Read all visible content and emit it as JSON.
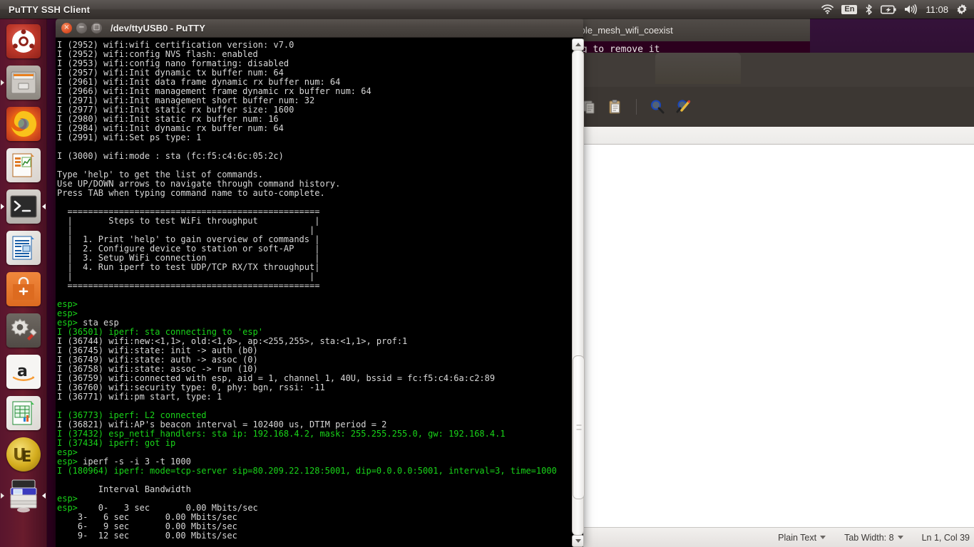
{
  "top_panel": {
    "app_title": "PuTTY SSH Client",
    "tray": {
      "wifi_icon": "wifi-icon",
      "keyboard_indicator": "En",
      "bluetooth_icon": "bluetooth-icon",
      "battery_icon": "battery-charging-icon",
      "volume_icon": "volume-icon",
      "clock": "11:08",
      "system_menu_icon": "gear-icon"
    }
  },
  "launcher": {
    "items": [
      {
        "name": "ubuntu-dash",
        "label": "Ubuntu Dash",
        "icon": "ubuntu-logo-icon"
      },
      {
        "name": "files",
        "label": "Files",
        "icon": "file-cabinet-icon"
      },
      {
        "name": "firefox",
        "label": "Firefox Web Browser",
        "icon": "firefox-icon"
      },
      {
        "name": "libreoffice-impress",
        "label": "LibreOffice Impress",
        "icon": "presentation-icon"
      },
      {
        "name": "terminal",
        "label": "Terminal",
        "icon": "terminal-icon"
      },
      {
        "name": "libreoffice-writer",
        "label": "LibreOffice Writer",
        "icon": "document-icon"
      },
      {
        "name": "ubuntu-software",
        "label": "Ubuntu Software",
        "icon": "software-bag-icon"
      },
      {
        "name": "system-settings",
        "label": "System Settings",
        "icon": "gear-wrench-icon"
      },
      {
        "name": "amazon",
        "label": "Amazon",
        "icon": "amazon-icon"
      },
      {
        "name": "libreoffice-calc",
        "label": "LibreOffice Calc",
        "icon": "spreadsheet-icon"
      },
      {
        "name": "ultraedit",
        "label": "UltraEdit",
        "icon": "ue-icon"
      },
      {
        "name": "workspace-switcher",
        "label": "Workspace Switcher",
        "icon": "window-stack-icon"
      }
    ]
  },
  "putty_window": {
    "title": "/dev/ttyUSB0 - PuTTY",
    "close_label": "×",
    "minimize_label": "−",
    "maximize_label": "□",
    "terminal_lines": [
      {
        "t": "I (2952) wifi:wifi certification version: v7.0",
        "c": "white"
      },
      {
        "t": "I (2952) wifi:config NVS flash: enabled",
        "c": "white"
      },
      {
        "t": "I (2953) wifi:config nano formating: disabled",
        "c": "white"
      },
      {
        "t": "I (2957) wifi:Init dynamic tx buffer num: 64",
        "c": "white"
      },
      {
        "t": "I (2961) wifi:Init data frame dynamic rx buffer num: 64",
        "c": "white"
      },
      {
        "t": "I (2966) wifi:Init management frame dynamic rx buffer num: 64",
        "c": "white"
      },
      {
        "t": "I (2971) wifi:Init management short buffer num: 32",
        "c": "white"
      },
      {
        "t": "I (2977) wifi:Init static rx buffer size: 1600",
        "c": "white"
      },
      {
        "t": "I (2980) wifi:Init static rx buffer num: 16",
        "c": "white"
      },
      {
        "t": "I (2984) wifi:Init dynamic rx buffer num: 64",
        "c": "white"
      },
      {
        "t": "I (2991) wifi:Set ps type: 1",
        "c": "white"
      },
      {
        "t": "",
        "c": "white"
      },
      {
        "t": "I (3000) wifi:mode : sta (fc:f5:c4:6c:05:2c)",
        "c": "white"
      },
      {
        "t": "",
        "c": "white"
      },
      {
        "t": "Type 'help' to get the list of commands.",
        "c": "white"
      },
      {
        "t": "Use UP/DOWN arrows to navigate through command history.",
        "c": "white"
      },
      {
        "t": "Press TAB when typing command name to auto-complete.",
        "c": "white"
      },
      {
        "t": "",
        "c": "white"
      },
      {
        "t": "  =================================================",
        "c": "white"
      },
      {
        "t": "  |       Steps to test WiFi throughput           |",
        "c": "white"
      },
      {
        "t": "  |                                              |",
        "c": "white"
      },
      {
        "t": "  |  1. Print 'help' to gain overview of commands |",
        "c": "white"
      },
      {
        "t": "  |  2. Configure device to station or soft-AP    |",
        "c": "white"
      },
      {
        "t": "  |  3. Setup WiFi connection                     |",
        "c": "white"
      },
      {
        "t": "  |  4. Run iperf to test UDP/TCP RX/TX throughput|",
        "c": "white"
      },
      {
        "t": "  |                                              |",
        "c": "white"
      },
      {
        "t": "  =================================================",
        "c": "white"
      },
      {
        "t": "",
        "c": "white"
      },
      {
        "t": "esp>",
        "c": "green"
      },
      {
        "t": "esp>",
        "c": "green"
      },
      {
        "t": "esp> sta esp",
        "c": "prompt"
      },
      {
        "t": "I (36501) iperf: sta connecting to 'esp'",
        "c": "green"
      },
      {
        "t": "I (36744) wifi:new:<1,1>, old:<1,0>, ap:<255,255>, sta:<1,1>, prof:1",
        "c": "white"
      },
      {
        "t": "I (36745) wifi:state: init -> auth (b0)",
        "c": "white"
      },
      {
        "t": "I (36749) wifi:state: auth -> assoc (0)",
        "c": "white"
      },
      {
        "t": "I (36758) wifi:state: assoc -> run (10)",
        "c": "white"
      },
      {
        "t": "I (36759) wifi:connected with esp, aid = 1, channel 1, 40U, bssid = fc:f5:c4:6a:c2:89",
        "c": "white"
      },
      {
        "t": "I (36760) wifi:security type: 0, phy: bgn, rssi: -11",
        "c": "white"
      },
      {
        "t": "I (36771) wifi:pm start, type: 1",
        "c": "white"
      },
      {
        "t": "",
        "c": "white"
      },
      {
        "t": "I (36773) iperf: L2 connected",
        "c": "green"
      },
      {
        "t": "I (36821) wifi:AP's beacon interval = 102400 us, DTIM period = 2",
        "c": "white"
      },
      {
        "t": "I (37432) esp_netif_handlers: sta ip: 192.168.4.2, mask: 255.255.255.0, gw: 192.168.4.1",
        "c": "green"
      },
      {
        "t": "I (37434) iperf: got ip",
        "c": "green"
      },
      {
        "t": "esp>",
        "c": "green"
      },
      {
        "t": "esp> iperf -s -i 3 -t 1000",
        "c": "prompt"
      },
      {
        "t": "I (180964) iperf: mode=tcp-server sip=80.209.22.128:5001, dip=0.0.0.0:5001, interval=3, time=1000",
        "c": "green"
      },
      {
        "t": "",
        "c": "white"
      },
      {
        "t": "        Interval Bandwidth",
        "c": "white"
      },
      {
        "t": "esp>",
        "c": "green"
      },
      {
        "t": "esp>    0-   3 sec       0.00 Mbits/sec",
        "c": "prompt"
      },
      {
        "t": "    3-   6 sec       0.00 Mbits/sec",
        "c": "white"
      },
      {
        "t": "    6-   9 sec       0.00 Mbits/sec",
        "c": "white"
      },
      {
        "t": "    9-  12 sec       0.00 Mbits/sec",
        "c": "white"
      }
    ],
    "scrollbar": {
      "up_arrow_icon": "scroll-up-arrow-icon",
      "down_arrow_icon": "scroll-down-arrow-icon"
    }
  },
  "background_window": {
    "title": "/ble_mesh_wifi_coexist",
    "snippet_text": "ng to remove it",
    "toolbar": [
      {
        "name": "copy-button",
        "icon": "copy-icon"
      },
      {
        "name": "paste-button",
        "icon": "paste-icon"
      },
      {
        "name": "find-button",
        "icon": "search-icon"
      },
      {
        "name": "replace-button",
        "icon": "find-replace-icon"
      }
    ],
    "statusbar": {
      "language": "Plain Text",
      "tab_width": "Tab Width: 8",
      "cursor_position": "Ln 1, Col 39"
    }
  },
  "colors": {
    "terminal_bg": "#000000",
    "terminal_green": "#19d419",
    "terminal_white": "#d8d8d8",
    "panel_bg": "#3f3a37",
    "launcher_bg": "#6e1e2e",
    "desktop_bg": "#2c001e"
  }
}
